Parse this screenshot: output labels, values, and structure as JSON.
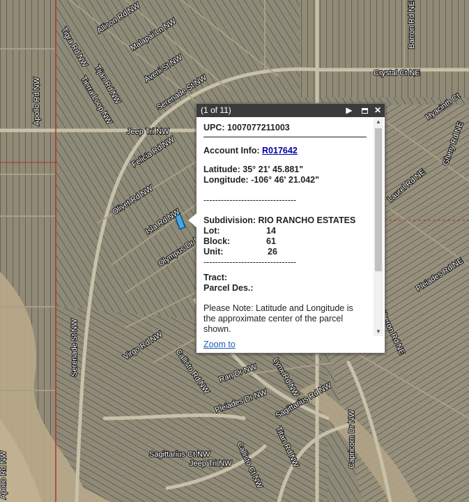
{
  "map": {
    "roads": [
      "Allison Rd NW",
      "Tigra Rd NW",
      "Malapai Ln NW",
      "Aveni St NW",
      "Tijan Rd NW",
      "Tierra Loop NW",
      "Serenade St NW",
      "Jeep Tri NW",
      "Felicia Rd NW",
      "Olivet Rd NW",
      "Isla Rd NW",
      "Olympus Dr NW",
      "Apollo Rd NW",
      "Serenade St NW",
      "Virgo Rd NW",
      "Callisto Rd NW",
      "Ran Dr NW",
      "Lynx Rd NW",
      "Pleiades Dr NW",
      "Sagittarius Rd NW",
      "Titan Rd NW",
      "Capricorn Dr NW",
      "Sagittarius Ct NW",
      "Jeep Tri NW",
      "Callisto Ct NW",
      "Crystal Ct NE",
      "Barron Rd NE",
      "Hyacinth Ct",
      "Pleiades Rd NE",
      "Oberon Rd NE",
      "Apollo Rd NW",
      "Laurel Rd NE",
      "Ghery Rd NE"
    ]
  },
  "popup": {
    "count": "(1 of 11)",
    "upc_label": "UPC:",
    "upc_value": "1007077211003",
    "account_label": "Account Info:",
    "account_value": "R017642",
    "lat_label": "Latitude:",
    "lat_value": "35° 21' 45.881\"",
    "lon_label": "Longitude:",
    "lon_value": "-106° 46' 21.042\"",
    "separator": "--------------------------------",
    "subdivision_label": "Subdivision:",
    "subdivision_value": "RIO RANCHO ESTATES",
    "lot_label": "Lot:",
    "lot_value": "14",
    "block_label": "Block:",
    "block_value": "61",
    "unit_label": "Unit:",
    "unit_value": "26",
    "tract_label": "Tract:",
    "parcel_label": "Parcel Des.:",
    "note": "Please Note: Latitude and Longitude is the approximate center of the parcel shown.",
    "zoom_label": "Zoom to"
  }
}
